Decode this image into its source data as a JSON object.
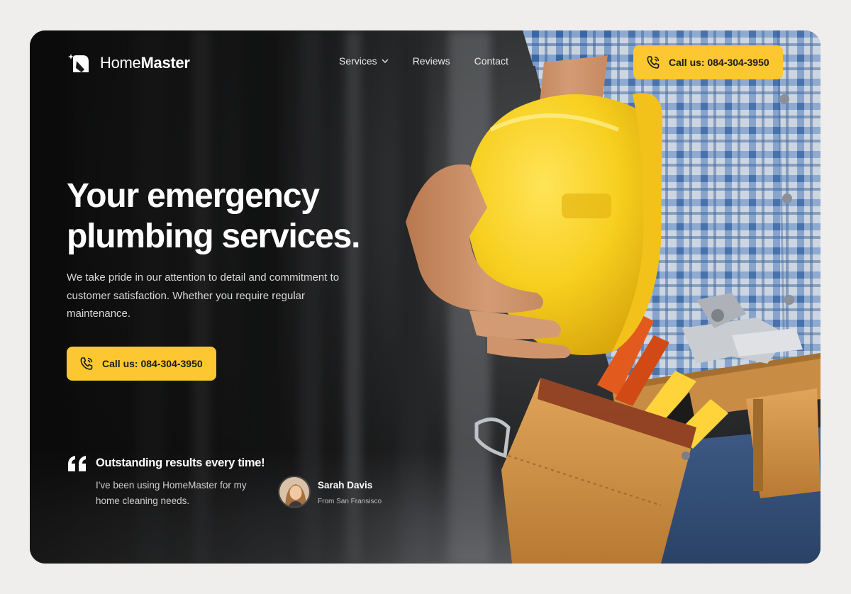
{
  "brand": {
    "name_light": "Home",
    "name_bold": "Master"
  },
  "nav": {
    "items": [
      {
        "label": "Services",
        "has_dropdown": true
      },
      {
        "label": "Reviews"
      },
      {
        "label": "Contact"
      }
    ],
    "cta_label": "Call us: 084-304-3950"
  },
  "hero": {
    "title_line1": "Your emergency",
    "title_line2": "plumbing services.",
    "subtitle": "We take pride in our attention to detail and commitment to customer satisfaction. Whether you require regular maintenance.",
    "cta_label": "Call us: 084-304-3950"
  },
  "testimonial": {
    "title": "Outstanding results every time!",
    "text": "I've been using HomeMaster for my home cleaning needs.",
    "author_name": "Sarah Davis",
    "author_from": "From San Fransisco"
  },
  "colors": {
    "accent": "#fcc730",
    "background": "#efeeec",
    "card_dark": "#1a1a1a"
  },
  "icons": [
    "homemaster-logo-icon",
    "chevron-down-icon",
    "phone-icon",
    "quote-icon"
  ]
}
